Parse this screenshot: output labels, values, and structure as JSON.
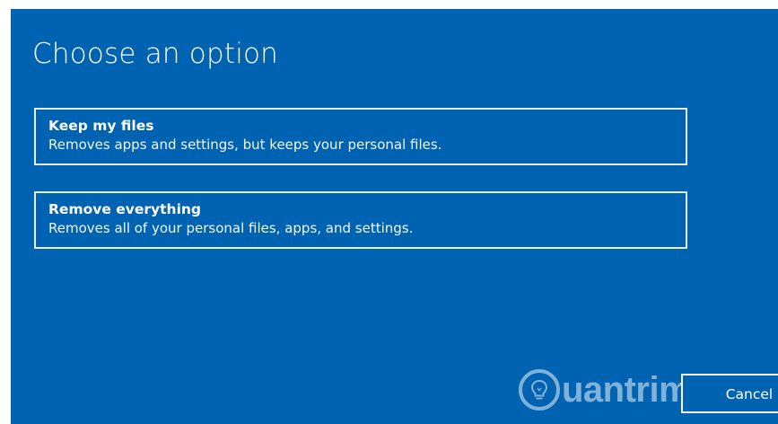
{
  "page": {
    "title": "Choose an option"
  },
  "options": [
    {
      "title": "Keep my files",
      "description": "Removes apps and settings, but keeps your personal files."
    },
    {
      "title": "Remove everything",
      "description": "Removes all of your personal files, apps, and settings."
    }
  ],
  "footer": {
    "cancel_label": "Cancel"
  },
  "watermark": {
    "text": "uantrimang",
    "icon": "lightbulb-icon"
  },
  "colors": {
    "background": "#0063b1",
    "text": "#ffffff",
    "border": "#e9eef5"
  }
}
